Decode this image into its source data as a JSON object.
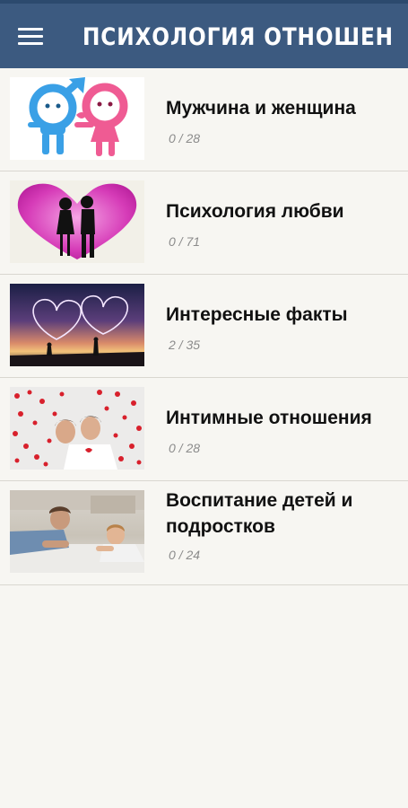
{
  "app": {
    "title": "ПСИХОЛОГИЯ ОТНОШЕН...",
    "menu_icon": "hamburger-menu-icon",
    "colors": {
      "appbar": "#3c5a80",
      "background": "#f7f6f2",
      "title_text": "#ffffff"
    }
  },
  "categories": [
    {
      "title": "Мужчина и женщина",
      "progress": "0 / 28",
      "image": "gender-symbols-image"
    },
    {
      "title": "Психология любви",
      "progress": "0 / 71",
      "image": "kissing-couple-heart-image"
    },
    {
      "title": "Интересные факты",
      "progress": "2 / 35",
      "image": "sunset-hearts-couple-image"
    },
    {
      "title": "Интимные отношения",
      "progress": "0 / 28",
      "image": "couple-rose-petals-image"
    },
    {
      "title": "Воспитание детей и подростков",
      "progress": "0 / 24",
      "image": "father-son-floor-image"
    }
  ]
}
